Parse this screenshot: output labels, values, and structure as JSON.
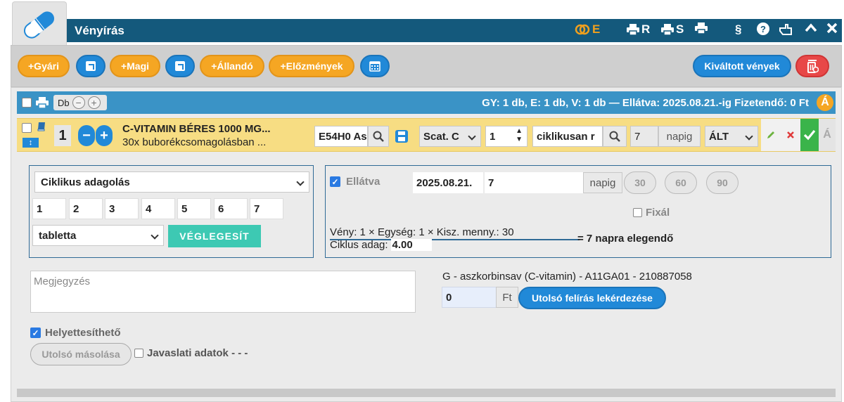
{
  "header": {
    "title": "Vényírás",
    "e_label": "E",
    "r_label": "R",
    "s_label": "S",
    "paragraph_label": "§"
  },
  "toolbar": {
    "gyari": "+Gyári",
    "magi": "+Magi",
    "allando": "+Állandó",
    "elozmenyek": "+Előzmények",
    "kivaltott": "Kiváltott vények"
  },
  "summary": {
    "db": "Db",
    "text": "GY: 1 db,  E: 1 db,  V: 1 db  —  Ellátva: 2025.08.21.-ig  Fizetendő: 0 Ft",
    "badge": "Á"
  },
  "drug": {
    "qty": "1",
    "name": "C-VITAMIN BÉRES 1000 MG...",
    "sub": "30x buborékcsomagolásban ...",
    "code": "E54H0 As",
    "scat": "Scat. C",
    "count": "1",
    "mode": "ciklikusan r",
    "days": "7",
    "days_unit": "napig",
    "alt": "ÁLT",
    "a_label": "Á"
  },
  "cycle": {
    "select": "Ciklikus adagolás",
    "days": [
      "1",
      "2",
      "3",
      "4",
      "5",
      "6",
      "7"
    ],
    "unit": "tabletta",
    "finalize": "VÉGLEGESÍT"
  },
  "supply": {
    "label": "Ellátva",
    "date": "2025.08.21.",
    "days": "7",
    "unit": "napig",
    "opts": [
      "30",
      "60",
      "90"
    ],
    "fixal": "Fixál",
    "formula": "Vény: 1 × Egység: 1 × Kisz. menny.: 30",
    "cycle_label": "Ciklus adag:",
    "cycle_value": "4.00",
    "result": "= 7 napra elegendő"
  },
  "details": {
    "note_placeholder": "Megjegyzés",
    "substance": "G - aszkorbinsav (C-vitamin) - A11GA01 - 210887058",
    "price": "0",
    "currency": "Ft",
    "last_query": "Utolsó felírás lekérdezése",
    "replaceable": "Helyettesíthető",
    "copy_last": "Utolsó másolása",
    "suggest": "Javaslati adatok - - -"
  }
}
